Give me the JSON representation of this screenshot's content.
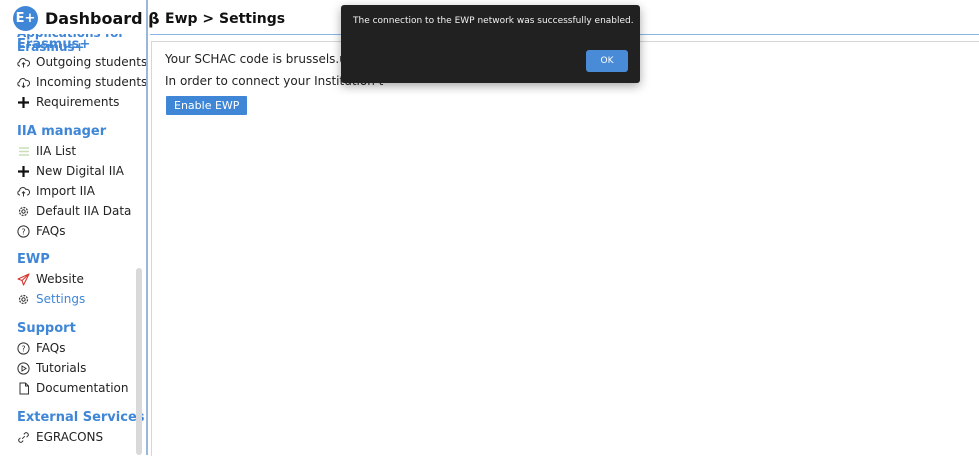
{
  "header": {
    "brand_badge": "E+",
    "brand_title": "Dashboard β",
    "page_title": "Ewp > Settings"
  },
  "sidebar": {
    "cut_section": "Applications for Erasmus+",
    "applications": {
      "title": "Erasmus+",
      "items": [
        {
          "label": "Outgoing students",
          "icon": "cloud-upload-icon"
        },
        {
          "label": "Incoming students",
          "icon": "cloud-download-icon"
        },
        {
          "label": "Requirements",
          "icon": "plus-icon"
        }
      ]
    },
    "iia": {
      "title": "IIA manager",
      "items": [
        {
          "label": "IIA List",
          "icon": "list-icon"
        },
        {
          "label": "New Digital IIA",
          "icon": "plus-icon"
        },
        {
          "label": "Import IIA",
          "icon": "cloud-upload-icon"
        },
        {
          "label": "Default IIA Data",
          "icon": "gear-icon"
        },
        {
          "label": "FAQs",
          "icon": "question-icon"
        }
      ]
    },
    "ewp": {
      "title": "EWP",
      "items": [
        {
          "label": "Website",
          "icon": "paper-plane-icon"
        },
        {
          "label": "Settings",
          "icon": "gear-icon",
          "active": true
        }
      ]
    },
    "support": {
      "title": "Support",
      "items": [
        {
          "label": "FAQs",
          "icon": "question-icon"
        },
        {
          "label": "Tutorials",
          "icon": "play-circle-icon"
        },
        {
          "label": "Documentation",
          "icon": "document-icon"
        }
      ]
    },
    "external": {
      "title": "External Services",
      "items": [
        {
          "label": "EGRACONS",
          "icon": "link-icon"
        }
      ]
    }
  },
  "main": {
    "schac_text": "Your SCHAC code is brussels.uni-four",
    "connect_text": "In order to connect your Institution t",
    "enable_button": "Enable EWP"
  },
  "dialog": {
    "message": "The connection to the EWP network was successfully enabled.",
    "ok_label": "OK"
  },
  "colors": {
    "accent": "#3f86d6",
    "dialog_bg": "#212121"
  }
}
